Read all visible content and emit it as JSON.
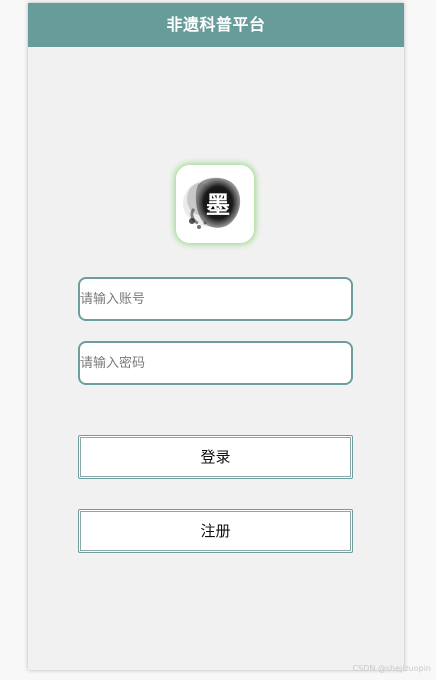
{
  "header": {
    "title": "非遗科普平台"
  },
  "logo": {
    "icon": "ink-brush-mo-icon",
    "glyph": "墨",
    "glow_color": "#a6dc96"
  },
  "form": {
    "account_placeholder": "请输入账号",
    "password_placeholder": "请输入密码",
    "login_label": "登录",
    "register_label": "注册"
  },
  "watermark": {
    "text": "CSDN @shejizuopin"
  },
  "colors": {
    "header_bg": "#679c9b",
    "border": "#6d9e9d",
    "page_bg": "#f1f1f1"
  }
}
